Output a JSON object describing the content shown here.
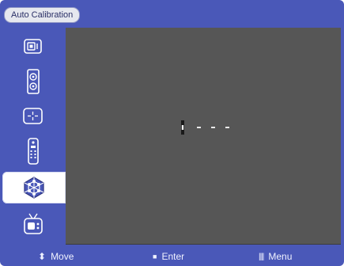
{
  "header": {
    "title": "Auto Calibration"
  },
  "sidebar": {
    "items": [
      {
        "icon": "picture-size-icon",
        "selected": false
      },
      {
        "icon": "speaker-icon",
        "selected": false
      },
      {
        "icon": "position-icon",
        "selected": false
      },
      {
        "icon": "remote-control-icon",
        "selected": false
      },
      {
        "icon": "auto-calibration-icon",
        "selected": true
      },
      {
        "icon": "tv-icon",
        "selected": false
      }
    ]
  },
  "progress": {
    "active_segments": 1,
    "total_segments": 4
  },
  "footer": {
    "move": {
      "glyph": "⬍",
      "label": "Move"
    },
    "enter": {
      "glyph": "■",
      "label": "Enter"
    },
    "menu": {
      "glyph": "||||",
      "label": "Menu"
    }
  },
  "colors": {
    "frame": "#4a58b8",
    "panel": "#565656",
    "selected_item": "#ffffff"
  }
}
